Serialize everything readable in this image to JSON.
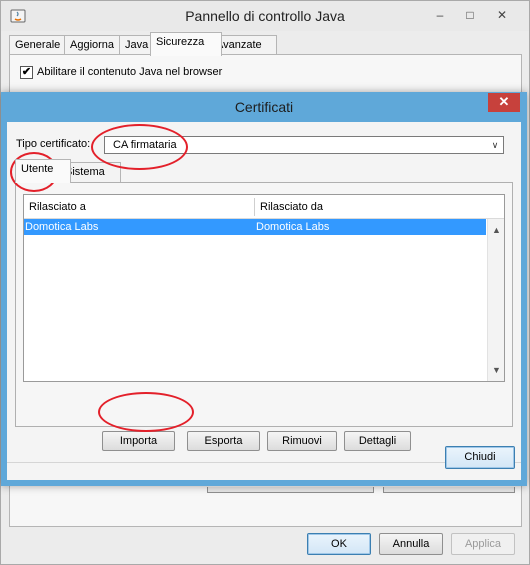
{
  "back_window": {
    "title": "Pannello di controllo Java",
    "controls": {
      "minimize": "–",
      "maximize": "□",
      "close": "✕"
    },
    "tabs": [
      {
        "label": "Generale"
      },
      {
        "label": "Aggiorna"
      },
      {
        "label": "Java"
      },
      {
        "label": "Sicurezza"
      },
      {
        "label": "Avanzate"
      }
    ],
    "active_tab": "Sicurezza",
    "enable_java_label": "Abilitare il contenuto Java nel browser",
    "enable_java_checked": true,
    "check_mark": "✔",
    "buttons": {
      "ok": "OK",
      "cancel": "Annulla",
      "apply": "Applica"
    }
  },
  "dialog": {
    "title": "Certificati",
    "close_glyph": "✕",
    "cert_type_label": "Tipo certificato:",
    "cert_type_value": "CA firmataria",
    "select_arrow": "∨",
    "tabs": [
      {
        "label": "Utente"
      },
      {
        "label": "Sistema"
      }
    ],
    "active_tab": "Utente",
    "table": {
      "columns": [
        "Rilasciato a",
        "Rilasciato da"
      ],
      "rows": [
        {
          "issued_to": "Domotica Labs",
          "issued_by": "Domotica Labs"
        }
      ],
      "scroll_up": "▲",
      "scroll_down": "▼"
    },
    "buttons": {
      "import": "Importa",
      "export": "Esporta",
      "remove": "Rimuovi",
      "details": "Dettagli",
      "close": "Chiudi"
    }
  },
  "colors": {
    "selection": "#3399ff",
    "dialog_frame": "#5fa8d9",
    "close_button": "#c7413c",
    "annotation": "#e3202a"
  }
}
